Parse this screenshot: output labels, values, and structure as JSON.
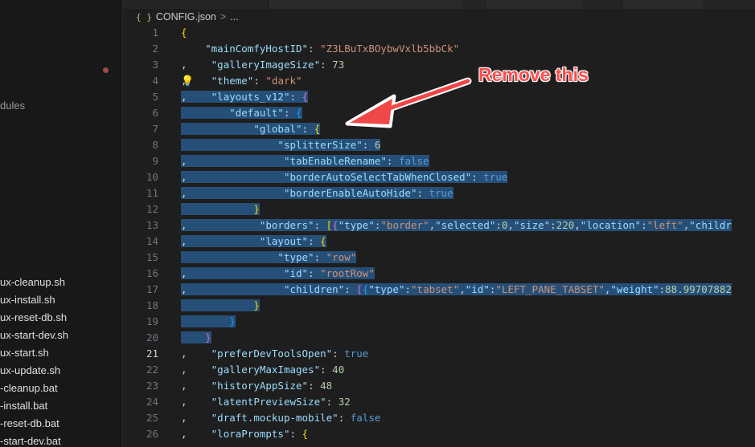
{
  "sidebar": {
    "explorer_fragment": "dules",
    "files": [
      "ux-cleanup.sh",
      "ux-install.sh",
      "ux-reset-db.sh",
      "ux-start-dev.sh",
      "ux-start.sh",
      "ux-update.sh",
      "-cleanup.bat",
      "-install.bat",
      "-reset-db.bat",
      "-start-dev.bat"
    ]
  },
  "breadcrumb": {
    "icon": "{ }",
    "file": "CONFIG.json",
    "sep": ">",
    "more": "..."
  },
  "annotation": "Remove this",
  "editor": {
    "line_numbers": [
      "1",
      "2",
      "3",
      "4",
      "5",
      "6",
      "7",
      "8",
      "9",
      "10",
      "11",
      "12",
      "13",
      "14",
      "15",
      "16",
      "17",
      "18",
      "19",
      "20",
      "21",
      "22",
      "23",
      "24",
      "25",
      "26"
    ],
    "active_line": "21",
    "lines": [
      {
        "ind": "",
        "tokens": [
          {
            "t": "{",
            "c": "br1"
          }
        ]
      },
      {
        "ind": "    ",
        "tokens": [
          {
            "t": "\"mainComfyHostID\"",
            "c": "k"
          },
          {
            "t": ": ",
            "c": "p"
          },
          {
            "t": "\"Z3LBuTxBOybwVxlb5bbCk\"",
            "c": "s"
          }
        ]
      },
      {
        "ind": ",    ",
        "tokens": [
          {
            "t": "\"galleryImageSize\"",
            "c": "k"
          },
          {
            "t": ": ",
            "c": "p"
          },
          {
            "t": "73",
            "c": "n"
          }
        ]
      },
      {
        "ind": ",    ",
        "tokens": [
          {
            "t": "\"theme\"",
            "c": "k"
          },
          {
            "t": ": ",
            "c": "p"
          },
          {
            "t": "\"dark\"",
            "c": "s"
          }
        ]
      },
      {
        "ind": ",    ",
        "sel": true,
        "tokens": [
          {
            "t": "\"layouts_v12\"",
            "c": "k"
          },
          {
            "t": ": ",
            "c": "p"
          },
          {
            "t": "{",
            "c": "br2"
          }
        ]
      },
      {
        "ind": "        ",
        "sel": true,
        "tokens": [
          {
            "t": "\"default\"",
            "c": "k"
          },
          {
            "t": ": ",
            "c": "p"
          },
          {
            "t": "{",
            "c": "br3"
          }
        ]
      },
      {
        "ind": "            ",
        "sel": true,
        "tokens": [
          {
            "t": "\"global\"",
            "c": "k"
          },
          {
            "t": ": ",
            "c": "p"
          },
          {
            "t": "{",
            "c": "br1"
          }
        ]
      },
      {
        "ind": "                ",
        "sel": true,
        "tokens": [
          {
            "t": "\"splitterSize\"",
            "c": "k"
          },
          {
            "t": ": ",
            "c": "p"
          },
          {
            "t": "6",
            "c": "n"
          }
        ]
      },
      {
        "ind": ",                ",
        "sel": true,
        "tokens": [
          {
            "t": "\"tabEnableRename\"",
            "c": "k"
          },
          {
            "t": ": ",
            "c": "p"
          },
          {
            "t": "false",
            "c": "b"
          }
        ]
      },
      {
        "ind": ",                ",
        "sel": true,
        "tokens": [
          {
            "t": "\"borderAutoSelectTabWhenClosed\"",
            "c": "k"
          },
          {
            "t": ": ",
            "c": "p"
          },
          {
            "t": "true",
            "c": "b"
          }
        ]
      },
      {
        "ind": ",                ",
        "sel": true,
        "tokens": [
          {
            "t": "\"borderEnableAutoHide\"",
            "c": "k"
          },
          {
            "t": ": ",
            "c": "p"
          },
          {
            "t": "true",
            "c": "b"
          }
        ]
      },
      {
        "ind": "            ",
        "sel": true,
        "tokens": [
          {
            "t": "}",
            "c": "br1"
          }
        ]
      },
      {
        "ind": ",            ",
        "sel": true,
        "tokens": [
          {
            "t": "\"borders\"",
            "c": "k"
          },
          {
            "t": ": ",
            "c": "p"
          },
          {
            "t": "[",
            "c": "br1"
          },
          {
            "t": "{",
            "c": "br2"
          },
          {
            "t": "\"type\"",
            "c": "k"
          },
          {
            "t": ":",
            "c": "p"
          },
          {
            "t": "\"border\"",
            "c": "s"
          },
          {
            "t": ",",
            "c": "p"
          },
          {
            "t": "\"selected\"",
            "c": "k"
          },
          {
            "t": ":",
            "c": "p"
          },
          {
            "t": "0",
            "c": "n"
          },
          {
            "t": ",",
            "c": "p"
          },
          {
            "t": "\"size\"",
            "c": "k"
          },
          {
            "t": ":",
            "c": "p"
          },
          {
            "t": "220",
            "c": "n"
          },
          {
            "t": ",",
            "c": "p"
          },
          {
            "t": "\"location\"",
            "c": "k"
          },
          {
            "t": ":",
            "c": "p"
          },
          {
            "t": "\"left\"",
            "c": "s"
          },
          {
            "t": ",",
            "c": "p"
          },
          {
            "t": "\"childr",
            "c": "k"
          }
        ]
      },
      {
        "ind": ",            ",
        "sel": true,
        "tokens": [
          {
            "t": "\"layout\"",
            "c": "k"
          },
          {
            "t": ": ",
            "c": "p"
          },
          {
            "t": "{",
            "c": "br1"
          }
        ]
      },
      {
        "ind": "                ",
        "sel": true,
        "tokens": [
          {
            "t": "\"type\"",
            "c": "k"
          },
          {
            "t": ": ",
            "c": "p"
          },
          {
            "t": "\"row\"",
            "c": "s"
          }
        ]
      },
      {
        "ind": ",                ",
        "sel": true,
        "tokens": [
          {
            "t": "\"id\"",
            "c": "k"
          },
          {
            "t": ": ",
            "c": "p"
          },
          {
            "t": "\"rootRow\"",
            "c": "s"
          }
        ]
      },
      {
        "ind": ",                ",
        "sel": true,
        "tokens": [
          {
            "t": "\"children\"",
            "c": "k"
          },
          {
            "t": ": ",
            "c": "p"
          },
          {
            "t": "[",
            "c": "br2"
          },
          {
            "t": "{",
            "c": "br3"
          },
          {
            "t": "\"type\"",
            "c": "k"
          },
          {
            "t": ":",
            "c": "p"
          },
          {
            "t": "\"tabset\"",
            "c": "s"
          },
          {
            "t": ",",
            "c": "p"
          },
          {
            "t": "\"id\"",
            "c": "k"
          },
          {
            "t": ":",
            "c": "p"
          },
          {
            "t": "\"LEFT_PANE_TABSET\"",
            "c": "s"
          },
          {
            "t": ",",
            "c": "p"
          },
          {
            "t": "\"weight\"",
            "c": "k"
          },
          {
            "t": ":",
            "c": "p"
          },
          {
            "t": "88.99707882",
            "c": "n"
          }
        ]
      },
      {
        "ind": "            ",
        "sel": true,
        "tokens": [
          {
            "t": "}",
            "c": "br1"
          }
        ]
      },
      {
        "ind": "        ",
        "sel": true,
        "tokens": [
          {
            "t": "}",
            "c": "br3"
          }
        ]
      },
      {
        "ind": "    ",
        "sel": true,
        "tokens": [
          {
            "t": "}",
            "c": "br2"
          }
        ]
      },
      {
        "ind": ",    ",
        "tokens": [
          {
            "t": "\"preferDevToolsOpen\"",
            "c": "k"
          },
          {
            "t": ": ",
            "c": "p"
          },
          {
            "t": "true",
            "c": "b"
          }
        ]
      },
      {
        "ind": ",    ",
        "tokens": [
          {
            "t": "\"galleryMaxImages\"",
            "c": "k"
          },
          {
            "t": ": ",
            "c": "p"
          },
          {
            "t": "40",
            "c": "n"
          }
        ]
      },
      {
        "ind": ",    ",
        "tokens": [
          {
            "t": "\"historyAppSize\"",
            "c": "k"
          },
          {
            "t": ": ",
            "c": "p"
          },
          {
            "t": "48",
            "c": "n"
          }
        ]
      },
      {
        "ind": ",    ",
        "tokens": [
          {
            "t": "\"latentPreviewSize\"",
            "c": "k"
          },
          {
            "t": ": ",
            "c": "p"
          },
          {
            "t": "32",
            "c": "n"
          }
        ]
      },
      {
        "ind": ",    ",
        "tokens": [
          {
            "t": "\"draft.mockup-mobile\"",
            "c": "k"
          },
          {
            "t": ": ",
            "c": "p"
          },
          {
            "t": "false",
            "c": "b"
          }
        ]
      },
      {
        "ind": ",    ",
        "tokens": [
          {
            "t": "\"loraPrompts\"",
            "c": "k"
          },
          {
            "t": ": ",
            "c": "p"
          },
          {
            "t": "{",
            "c": "br1"
          }
        ]
      }
    ]
  }
}
